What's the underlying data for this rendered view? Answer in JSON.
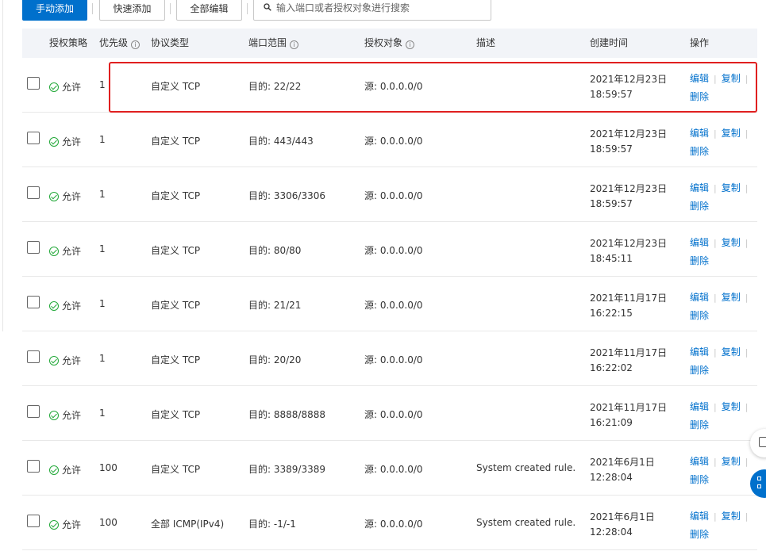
{
  "toolbar": {
    "manual_add": "手动添加",
    "quick_add": "快速添加",
    "bulk_edit": "全部编辑",
    "search_placeholder": "输入端口或者授权对象进行搜索"
  },
  "table": {
    "headers": {
      "policy": "授权策略",
      "priority": "优先级",
      "protocol": "协议类型",
      "port_range": "端口范围",
      "auth_object": "授权对象",
      "description": "描述",
      "created": "创建时间",
      "actions": "操作"
    },
    "action_labels": {
      "edit": "编辑",
      "copy": "复制",
      "delete": "删除"
    },
    "rows": [
      {
        "policy": "允许",
        "priority": "1",
        "protocol": "自定义 TCP",
        "port": "目的: 22/22",
        "auth": "源: 0.0.0.0/0",
        "desc": "",
        "date": "2021年12月23日",
        "time": "18:59:57"
      },
      {
        "policy": "允许",
        "priority": "1",
        "protocol": "自定义 TCP",
        "port": "目的: 443/443",
        "auth": "源: 0.0.0.0/0",
        "desc": "",
        "date": "2021年12月23日",
        "time": "18:59:57"
      },
      {
        "policy": "允许",
        "priority": "1",
        "protocol": "自定义 TCP",
        "port": "目的: 3306/3306",
        "auth": "源: 0.0.0.0/0",
        "desc": "",
        "date": "2021年12月23日",
        "time": "18:59:57"
      },
      {
        "policy": "允许",
        "priority": "1",
        "protocol": "自定义 TCP",
        "port": "目的: 80/80",
        "auth": "源: 0.0.0.0/0",
        "desc": "",
        "date": "2021年12月23日",
        "time": "18:45:11"
      },
      {
        "policy": "允许",
        "priority": "1",
        "protocol": "自定义 TCP",
        "port": "目的: 21/21",
        "auth": "源: 0.0.0.0/0",
        "desc": "",
        "date": "2021年11月17日",
        "time": "16:22:15"
      },
      {
        "policy": "允许",
        "priority": "1",
        "protocol": "自定义 TCP",
        "port": "目的: 20/20",
        "auth": "源: 0.0.0.0/0",
        "desc": "",
        "date": "2021年11月17日",
        "time": "16:22:02"
      },
      {
        "policy": "允许",
        "priority": "1",
        "protocol": "自定义 TCP",
        "port": "目的: 8888/8888",
        "auth": "源: 0.0.0.0/0",
        "desc": "",
        "date": "2021年11月17日",
        "time": "16:21:09"
      },
      {
        "policy": "允许",
        "priority": "100",
        "protocol": "自定义 TCP",
        "port": "目的: 3389/3389",
        "auth": "源: 0.0.0.0/0",
        "desc": "System created rule.",
        "date": "2021年6月1日",
        "time": "12:28:04"
      },
      {
        "policy": "允许",
        "priority": "100",
        "protocol": "全部 ICMP(IPv4)",
        "port": "目的: -1/-1",
        "auth": "源: 0.0.0.0/0",
        "desc": "System created rule.",
        "date": "2021年6月1日",
        "time": "12:28:04"
      }
    ]
  },
  "colors": {
    "primary": "#0070cc",
    "allow_green": "#22a838",
    "highlight_red": "#e02020",
    "header_bg": "#f2f4f8"
  }
}
